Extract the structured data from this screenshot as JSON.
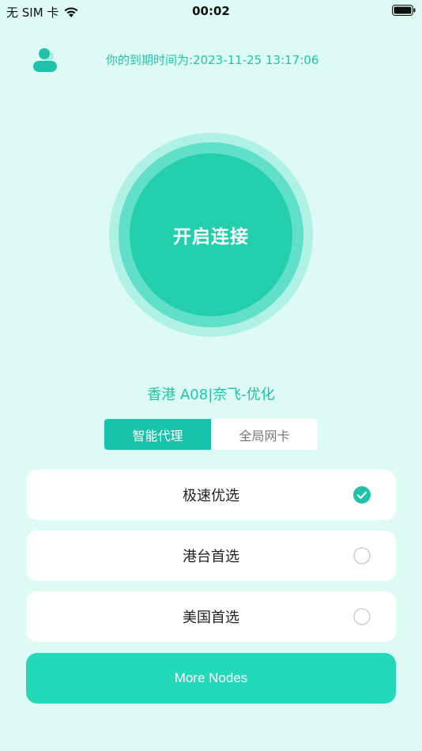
{
  "status_bar": {
    "carrier": "无 SIM 卡",
    "time": "00:02",
    "icons": [
      "wifi-icon",
      "battery-icon"
    ]
  },
  "header": {
    "user_icon": "user-icon",
    "expire_text": "你的到期时间为:2023-11-25 13:17:06"
  },
  "connect": {
    "label": "开启连接"
  },
  "node": {
    "name": "香港 A08|奈飞-优化"
  },
  "modes": [
    {
      "label": "智能代理",
      "active": true
    },
    {
      "label": "全局网卡",
      "active": false
    }
  ],
  "options": [
    {
      "label": "极速优选",
      "selected": true
    },
    {
      "label": "港台首选",
      "selected": false
    },
    {
      "label": "美国首选",
      "selected": false
    }
  ],
  "more_button": {
    "label": "More Nodes"
  },
  "colors": {
    "background": "#DDFAF5",
    "accent": "#1FC3AA",
    "button": "#22DABA",
    "connect_core": "#24CFAE"
  }
}
